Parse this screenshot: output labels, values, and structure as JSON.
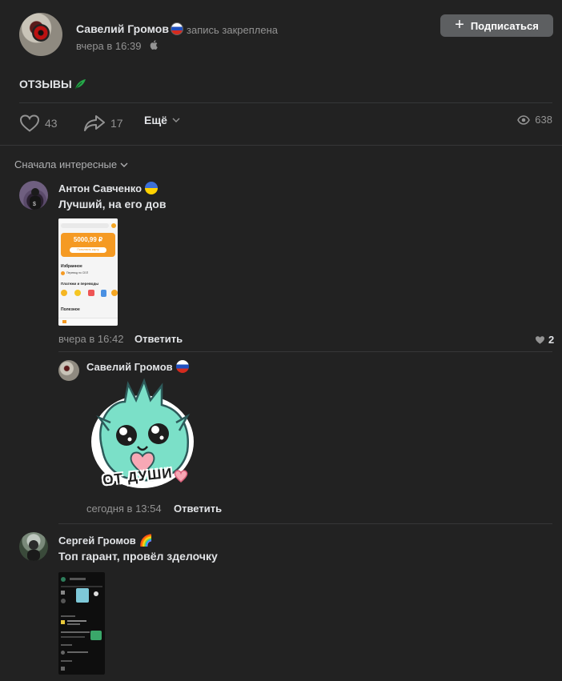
{
  "post": {
    "author": "Савелий Громов",
    "pinned_label": "запись закреплена",
    "date": "вчера в 16:39",
    "subscribe_label": "Подписаться",
    "text": "ОТЗЫВЫ",
    "likes": "43",
    "shares": "17",
    "more_label": "Ещё",
    "views": "638"
  },
  "sort_label": "Сначала интересные",
  "comments": [
    {
      "author": "Антон Савченко",
      "text": "Лучший, на его дов",
      "date": "вчера в 16:42",
      "reply_label": "Ответить",
      "likes": "2",
      "screenshot": {
        "balance": "5000,99 ₽",
        "button": "Пополнить карту",
        "favorites": "Избранное",
        "fav_item": "Перевод по СБП",
        "payments": "Платежи и переводы",
        "useful": "Полезное"
      }
    },
    {
      "author": "Савелий Громов",
      "sticker_text": "ОТ ДУШИ",
      "date": "сегодня в 13:54",
      "reply_label": "Ответить"
    },
    {
      "author": "Сергей Громов",
      "text": "Топ гарант, провёл зделочку",
      "emoji": "🌈"
    }
  ],
  "colors": {
    "background": "#222222",
    "text": "#e1e3e6",
    "muted": "#939393",
    "button": "#5d5f61"
  }
}
